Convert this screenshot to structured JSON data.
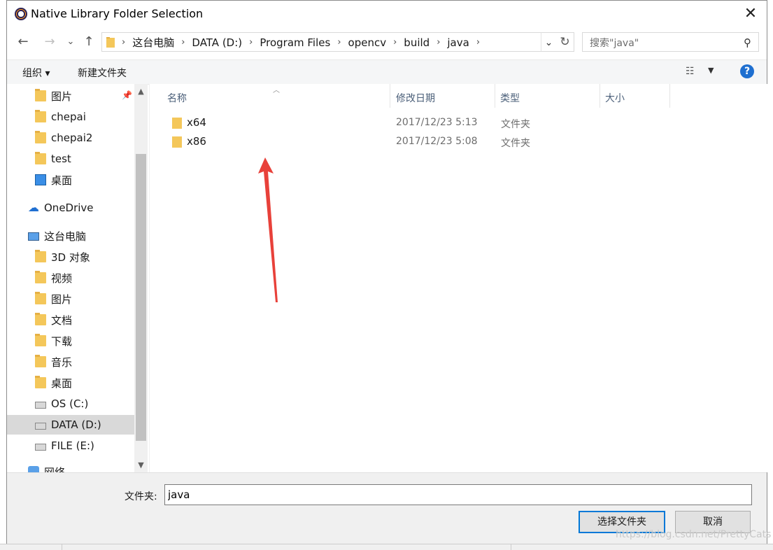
{
  "window": {
    "title": "Native Library Folder Selection",
    "close_glyph": "✕"
  },
  "nav": {
    "back": "←",
    "forward": "→",
    "recent": "⌄",
    "up": "↑",
    "breadcrumbs": [
      "这台电脑",
      "DATA (D:)",
      "Program Files",
      "opencv",
      "build",
      "java"
    ],
    "search_placeholder": "搜索\"java\""
  },
  "toolbar": {
    "organize": "组织 ▾",
    "new_folder": "新建文件夹",
    "help": "?"
  },
  "sidebar": {
    "items": [
      {
        "label": "图片",
        "icon": "pictures-icon",
        "pinned": true
      },
      {
        "label": "chepai",
        "icon": "folder-icon"
      },
      {
        "label": "chepai2",
        "icon": "folder-icon"
      },
      {
        "label": "test",
        "icon": "folder-icon"
      },
      {
        "label": "桌面",
        "icon": "desktop-icon"
      },
      {
        "label": "OneDrive",
        "icon": "cloud-icon"
      },
      {
        "label": "这台电脑",
        "icon": "computer-icon"
      },
      {
        "label": "3D 对象",
        "icon": "3d-objects-icon"
      },
      {
        "label": "视频",
        "icon": "videos-icon"
      },
      {
        "label": "图片",
        "icon": "pictures-icon"
      },
      {
        "label": "文档",
        "icon": "documents-icon"
      },
      {
        "label": "下载",
        "icon": "downloads-icon"
      },
      {
        "label": "音乐",
        "icon": "music-icon"
      },
      {
        "label": "桌面",
        "icon": "desktop-icon"
      },
      {
        "label": "OS (C:)",
        "icon": "windows-drive-icon"
      },
      {
        "label": "DATA (D:)",
        "icon": "drive-icon",
        "selected": true
      },
      {
        "label": "FILE (E:)",
        "icon": "drive-icon"
      },
      {
        "label": "网络",
        "icon": "network-icon"
      }
    ]
  },
  "list": {
    "headers": {
      "name": "名称",
      "modified": "修改日期",
      "type": "类型",
      "size": "大小"
    },
    "rows": [
      {
        "name": "x64",
        "modified": "2017/12/23 5:13",
        "type": "文件夹"
      },
      {
        "name": "x86",
        "modified": "2017/12/23 5:08",
        "type": "文件夹"
      }
    ]
  },
  "footer": {
    "folder_label": "文件夹:",
    "folder_value": "java",
    "select_button": "选择文件夹",
    "cancel_button": "取消"
  },
  "watermark": "https://blog.csdn.net/PrettyCats",
  "colors": {
    "accent": "#0078d7",
    "folder": "#f4c75a",
    "arrow": "#e8413a"
  }
}
